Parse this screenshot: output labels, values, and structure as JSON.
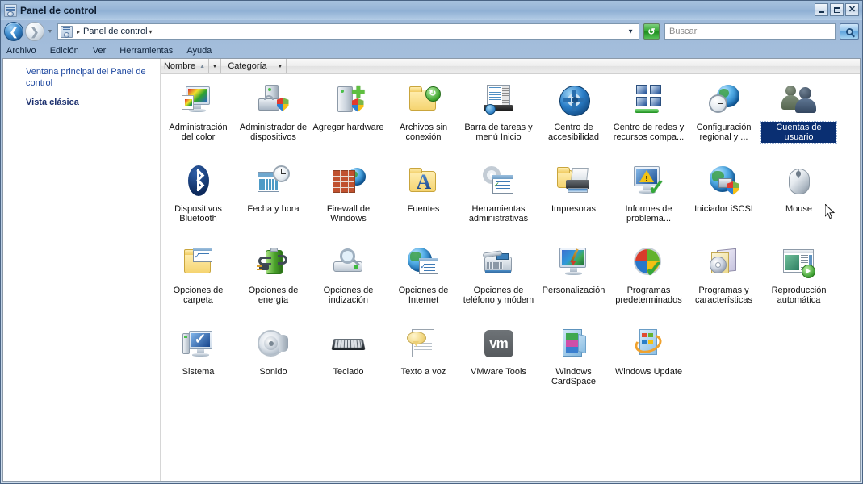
{
  "window": {
    "title": "Panel de control",
    "title_icon": "control-panel-icon",
    "buttons": {
      "minimize": "_",
      "maximize": "□",
      "close": "✕"
    }
  },
  "navbar": {
    "back_icon": "back-arrow-icon",
    "forward_icon": "forward-arrow-icon",
    "history_dropdown_icon": "chevron-down-icon",
    "address_icon": "control-panel-icon",
    "breadcrumb_separator": "▸",
    "breadcrumb": "Panel de control",
    "breadcrumb_caret": "▾",
    "address_dropdown_icon": "chevron-down-icon",
    "refresh_icon": "refresh-icon",
    "search_placeholder": "Buscar",
    "search_value": "",
    "search_button_icon": "search-icon"
  },
  "menubar": {
    "items": [
      {
        "label": "Archivo"
      },
      {
        "label": "Edición"
      },
      {
        "label": "Ver"
      },
      {
        "label": "Herramientas"
      },
      {
        "label": "Ayuda"
      }
    ]
  },
  "sidebar": {
    "main_link": "Ventana principal del Panel de control",
    "classic_link": "Vista clásica"
  },
  "columns": {
    "name": {
      "label": "Nombre",
      "sort_icon": "sort-ascending-icon",
      "dropdown_icon": "chevron-down-icon"
    },
    "category": {
      "label": "Categoría",
      "dropdown_icon": "chevron-down-icon"
    }
  },
  "colors": {
    "selection": "#0a2f72",
    "link": "#1f49a0",
    "link_bold": "#1b2f6e",
    "titlebar_text": "#0c1b2e"
  },
  "icon_grid": {
    "rows": [
      [
        {
          "label": "Administración del color",
          "icon": "color-management-icon",
          "selected": false
        },
        {
          "label": "Administrador de dispositivos",
          "icon": "device-manager-icon",
          "selected": false
        },
        {
          "label": "Agregar hardware",
          "icon": "add-hardware-icon",
          "selected": false
        },
        {
          "label": "Archivos sin conexión",
          "icon": "offline-files-icon",
          "selected": false
        },
        {
          "label": "Barra de tareas y menú Inicio",
          "icon": "taskbar-start-menu-icon",
          "selected": false
        },
        {
          "label": "Centro de accesibilidad",
          "icon": "ease-of-access-icon",
          "selected": false
        },
        {
          "label": "Centro de redes y recursos compa...",
          "icon": "network-sharing-center-icon",
          "selected": false
        },
        {
          "label": "Configuración regional y ...",
          "icon": "regional-settings-icon",
          "selected": false
        },
        {
          "label": "Cuentas de usuario",
          "icon": "user-accounts-icon",
          "selected": true
        }
      ],
      [
        {
          "label": "Dispositivos Bluetooth",
          "icon": "bluetooth-icon",
          "selected": false
        },
        {
          "label": "Fecha y hora",
          "icon": "date-time-icon",
          "selected": false
        },
        {
          "label": "Firewall de Windows",
          "icon": "windows-firewall-icon",
          "selected": false
        },
        {
          "label": "Fuentes",
          "icon": "fonts-icon",
          "selected": false
        },
        {
          "label": "Herramientas administrativas",
          "icon": "administrative-tools-icon",
          "selected": false
        },
        {
          "label": "Impresoras",
          "icon": "printers-icon",
          "selected": false
        },
        {
          "label": "Informes de problema...",
          "icon": "problem-reports-icon",
          "selected": false
        },
        {
          "label": "Iniciador iSCSI",
          "icon": "iscsi-initiator-icon",
          "selected": false
        },
        {
          "label": "Mouse",
          "icon": "mouse-icon",
          "selected": false
        }
      ],
      [
        {
          "label": "Opciones de carpeta",
          "icon": "folder-options-icon",
          "selected": false
        },
        {
          "label": "Opciones de energía",
          "icon": "power-options-icon",
          "selected": false
        },
        {
          "label": "Opciones de indización",
          "icon": "indexing-options-icon",
          "selected": false
        },
        {
          "label": "Opciones de Internet",
          "icon": "internet-options-icon",
          "selected": false
        },
        {
          "label": "Opciones de teléfono y módem",
          "icon": "phone-modem-options-icon",
          "selected": false
        },
        {
          "label": "Personalización",
          "icon": "personalization-icon",
          "selected": false
        },
        {
          "label": "Programas predeterminados",
          "icon": "default-programs-icon",
          "selected": false
        },
        {
          "label": "Programas y características",
          "icon": "programs-features-icon",
          "selected": false
        },
        {
          "label": "Reproducción automática",
          "icon": "autoplay-icon",
          "selected": false
        }
      ],
      [
        {
          "label": "Sistema",
          "icon": "system-icon",
          "selected": false
        },
        {
          "label": "Sonido",
          "icon": "sound-icon",
          "selected": false
        },
        {
          "label": "Teclado",
          "icon": "keyboard-icon",
          "selected": false
        },
        {
          "label": "Texto a voz",
          "icon": "text-to-speech-icon",
          "selected": false
        },
        {
          "label": "VMware Tools",
          "icon": "vmware-tools-icon",
          "selected": false
        },
        {
          "label": "Windows CardSpace",
          "icon": "windows-cardspace-icon",
          "selected": false
        },
        {
          "label": "Windows Update",
          "icon": "windows-update-icon",
          "selected": false
        }
      ]
    ]
  },
  "cursor": {
    "icon": "mouse-pointer-icon"
  }
}
